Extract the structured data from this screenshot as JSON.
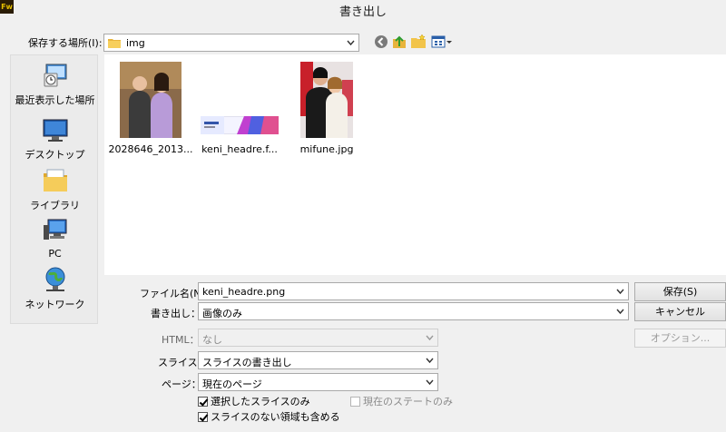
{
  "window": {
    "app_icon_text": "Fw",
    "title": "書き出し"
  },
  "look_in": {
    "label": "保存する場所(I):",
    "value": "img"
  },
  "places": [
    {
      "label": "最近表示した場所",
      "icon": "recent-places-icon"
    },
    {
      "label": "デスクトップ",
      "icon": "desktop-icon"
    },
    {
      "label": "ライブラリ",
      "icon": "libraries-icon"
    },
    {
      "label": "PC",
      "icon": "computer-icon"
    },
    {
      "label": "ネットワーク",
      "icon": "network-icon"
    }
  ],
  "files": [
    {
      "name": "2028646_2013...",
      "type": "photo"
    },
    {
      "name": "keni_headre.f...",
      "type": "banner"
    },
    {
      "name": "mifune.jpg",
      "type": "photo"
    }
  ],
  "form": {
    "filename_label": "ファイル名(N):",
    "filename_value": "keni_headre.png",
    "export_label": "書き出し：",
    "export_value": "画像のみ",
    "html_label": "HTML：",
    "html_value": "なし",
    "slices_label": "スライス：",
    "slices_value": "スライスの書き出し",
    "pages_label": "ページ：",
    "pages_value": "現在のページ"
  },
  "checkboxes": {
    "selected_slices_only": {
      "label": "選択したスライスのみ",
      "checked": true
    },
    "current_state_only": {
      "label": "現在のステートのみ",
      "checked": false
    },
    "include_areas_without_slices": {
      "label": "スライスのない領域も含める",
      "checked": true
    }
  },
  "buttons": {
    "save": "保存(S)",
    "cancel": "キャンセル",
    "options": "オプション..."
  }
}
